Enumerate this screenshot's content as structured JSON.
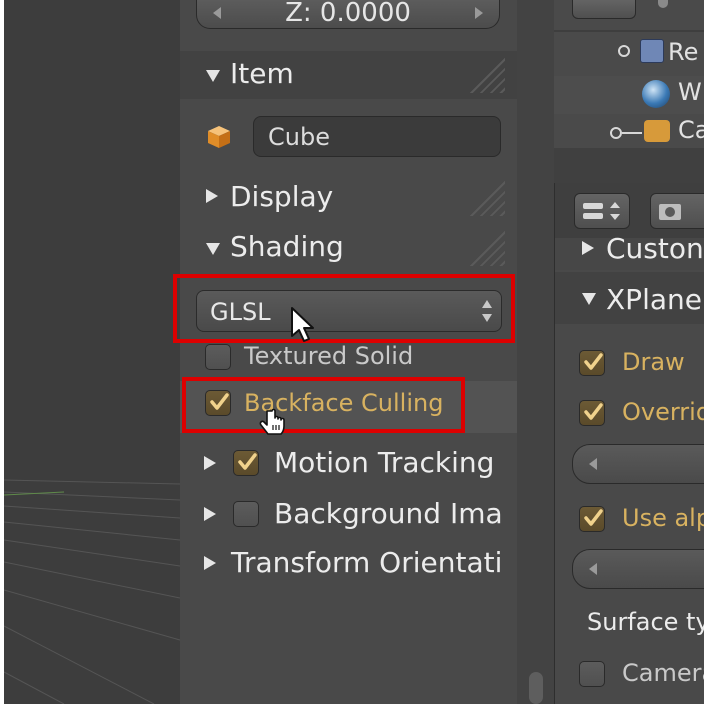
{
  "transform": {
    "z_field": "Z: 0.0000"
  },
  "item_panel": {
    "title": "Item",
    "object_name": "Cube"
  },
  "display_panel": {
    "title": "Display"
  },
  "shading_panel": {
    "title": "Shading",
    "mode": "GLSL",
    "textured_solid": {
      "label": "Textured Solid",
      "checked": false
    },
    "backface_culling": {
      "label": "Backface Culling",
      "checked": true
    }
  },
  "motion_tracking": {
    "label": "Motion Tracking",
    "checked": true
  },
  "background_images": {
    "label": "Background Ima",
    "checked": false
  },
  "transform_orientations": {
    "label": "Transform Orientati"
  },
  "outliner": {
    "items": [
      {
        "label": "Re",
        "icon": "render-layers-icon"
      },
      {
        "label": "W",
        "icon": "world-icon"
      },
      {
        "label": "Ca",
        "icon": "camera-object-icon"
      }
    ]
  },
  "properties": {
    "custom_header": "Custon",
    "xplane_header": "XPlane",
    "draw": {
      "label": "Draw",
      "checked": true
    },
    "override": {
      "label": "Overrid",
      "checked": true
    },
    "use_alpha": {
      "label": "Use alp",
      "checked": true
    },
    "surface_type_label": "Surface ty",
    "camera": {
      "label": "Camera",
      "checked": false
    }
  },
  "colors": {
    "highlight": "#dd0000",
    "checked_text": "#d8b260",
    "panel_bg": "#494949"
  }
}
